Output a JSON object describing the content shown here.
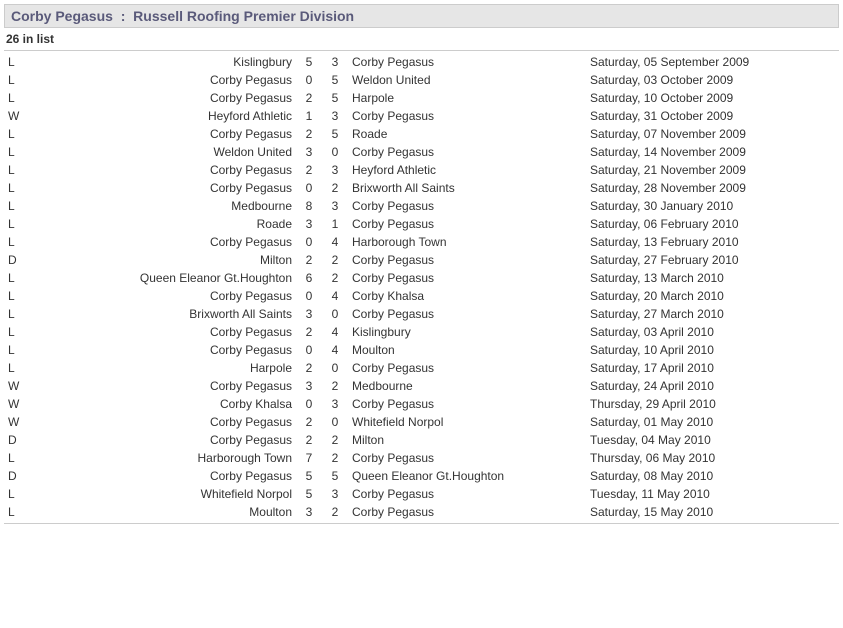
{
  "header": {
    "team": "Corby Pegasus",
    "sep": ":",
    "division": "Russell Roofing Premier Division"
  },
  "count_label": "26 in list",
  "matches": [
    {
      "r": "L",
      "home": "Kislingbury",
      "hs": 5,
      "as": 3,
      "away": "Corby Pegasus",
      "date": "Saturday, 05 September 2009"
    },
    {
      "r": "L",
      "home": "Corby Pegasus",
      "hs": 0,
      "as": 5,
      "away": "Weldon United",
      "date": "Saturday, 03 October 2009"
    },
    {
      "r": "L",
      "home": "Corby Pegasus",
      "hs": 2,
      "as": 5,
      "away": "Harpole",
      "date": "Saturday, 10 October 2009"
    },
    {
      "r": "W",
      "home": "Heyford Athletic",
      "hs": 1,
      "as": 3,
      "away": "Corby Pegasus",
      "date": "Saturday, 31 October 2009"
    },
    {
      "r": "L",
      "home": "Corby Pegasus",
      "hs": 2,
      "as": 5,
      "away": "Roade",
      "date": "Saturday, 07 November 2009"
    },
    {
      "r": "L",
      "home": "Weldon United",
      "hs": 3,
      "as": 0,
      "away": "Corby Pegasus",
      "date": "Saturday, 14 November 2009"
    },
    {
      "r": "L",
      "home": "Corby Pegasus",
      "hs": 2,
      "as": 3,
      "away": "Heyford Athletic",
      "date": "Saturday, 21 November 2009"
    },
    {
      "r": "L",
      "home": "Corby Pegasus",
      "hs": 0,
      "as": 2,
      "away": "Brixworth All Saints",
      "date": "Saturday, 28 November 2009"
    },
    {
      "r": "L",
      "home": "Medbourne",
      "hs": 8,
      "as": 3,
      "away": "Corby Pegasus",
      "date": "Saturday, 30 January 2010"
    },
    {
      "r": "L",
      "home": "Roade",
      "hs": 3,
      "as": 1,
      "away": "Corby Pegasus",
      "date": "Saturday, 06 February 2010"
    },
    {
      "r": "L",
      "home": "Corby Pegasus",
      "hs": 0,
      "as": 4,
      "away": "Harborough Town",
      "date": "Saturday, 13 February 2010"
    },
    {
      "r": "D",
      "home": "Milton",
      "hs": 2,
      "as": 2,
      "away": "Corby Pegasus",
      "date": "Saturday, 27 February 2010"
    },
    {
      "r": "L",
      "home": "Queen Eleanor Gt.Houghton",
      "hs": 6,
      "as": 2,
      "away": "Corby Pegasus",
      "date": "Saturday, 13 March 2010"
    },
    {
      "r": "L",
      "home": "Corby Pegasus",
      "hs": 0,
      "as": 4,
      "away": "Corby Khalsa",
      "date": "Saturday, 20 March 2010"
    },
    {
      "r": "L",
      "home": "Brixworth All Saints",
      "hs": 3,
      "as": 0,
      "away": "Corby Pegasus",
      "date": "Saturday, 27 March 2010"
    },
    {
      "r": "L",
      "home": "Corby Pegasus",
      "hs": 2,
      "as": 4,
      "away": "Kislingbury",
      "date": "Saturday, 03 April 2010"
    },
    {
      "r": "L",
      "home": "Corby Pegasus",
      "hs": 0,
      "as": 4,
      "away": "Moulton",
      "date": "Saturday, 10 April 2010"
    },
    {
      "r": "L",
      "home": "Harpole",
      "hs": 2,
      "as": 0,
      "away": "Corby Pegasus",
      "date": "Saturday, 17 April 2010"
    },
    {
      "r": "W",
      "home": "Corby Pegasus",
      "hs": 3,
      "as": 2,
      "away": "Medbourne",
      "date": "Saturday, 24 April 2010"
    },
    {
      "r": "W",
      "home": "Corby Khalsa",
      "hs": 0,
      "as": 3,
      "away": "Corby Pegasus",
      "date": "Thursday, 29 April 2010"
    },
    {
      "r": "W",
      "home": "Corby Pegasus",
      "hs": 2,
      "as": 0,
      "away": "Whitefield Norpol",
      "date": "Saturday, 01 May 2010"
    },
    {
      "r": "D",
      "home": "Corby Pegasus",
      "hs": 2,
      "as": 2,
      "away": "Milton",
      "date": "Tuesday, 04 May 2010"
    },
    {
      "r": "L",
      "home": "Harborough Town",
      "hs": 7,
      "as": 2,
      "away": "Corby Pegasus",
      "date": "Thursday, 06 May 2010"
    },
    {
      "r": "D",
      "home": "Corby Pegasus",
      "hs": 5,
      "as": 5,
      "away": "Queen Eleanor Gt.Houghton",
      "date": "Saturday, 08 May 2010"
    },
    {
      "r": "L",
      "home": "Whitefield Norpol",
      "hs": 5,
      "as": 3,
      "away": "Corby Pegasus",
      "date": "Tuesday, 11 May 2010"
    },
    {
      "r": "L",
      "home": "Moulton",
      "hs": 3,
      "as": 2,
      "away": "Corby Pegasus",
      "date": "Saturday, 15 May 2010"
    }
  ]
}
